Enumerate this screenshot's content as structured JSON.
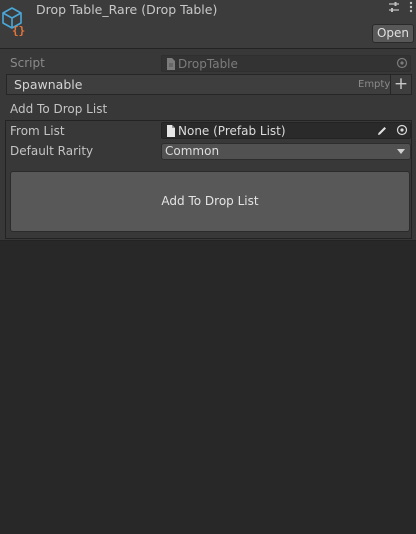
{
  "header": {
    "title": "Drop Table_Rare (Drop Table)",
    "open_label": "Open",
    "icons": [
      "script-asset-icon",
      "settings-sliders-icon",
      "more-options-icon"
    ]
  },
  "script_row": {
    "label": "Script",
    "value": "DropTable"
  },
  "spawnable": {
    "label": "Spawnable",
    "status": "Empty",
    "add_symbol": "+"
  },
  "section": {
    "title": "Add To Drop List"
  },
  "from_list": {
    "label": "From List",
    "value": "None (Prefab List)"
  },
  "default_rarity": {
    "label": "Default Rarity",
    "selected": "Common"
  },
  "action": {
    "label": "Add To Drop List"
  },
  "colors": {
    "background": "#282828",
    "panel": "#383838",
    "header": "#3c3c3c",
    "icon_blue": "#4aa8d8",
    "icon_orange": "#e8763a"
  }
}
